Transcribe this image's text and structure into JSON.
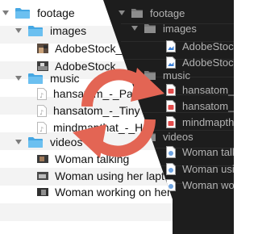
{
  "light_panel": {
    "items": [
      {
        "label": "footage",
        "icon": "folder-icon",
        "type": "folder"
      },
      {
        "label": "images",
        "icon": "folder-icon",
        "type": "folder"
      },
      {
        "label": "AdobeStock_",
        "icon": "image-thumbnail-icon",
        "type": "file"
      },
      {
        "label": "AdobeStock_",
        "icon": "image-thumbnail-icon",
        "type": "file"
      },
      {
        "label": "music",
        "icon": "folder-icon",
        "type": "folder"
      },
      {
        "label": "hansatom_-_Pa",
        "icon": "audio-file-icon",
        "type": "file"
      },
      {
        "label": "hansatom_-_Tiny",
        "icon": "audio-file-icon",
        "type": "file"
      },
      {
        "label": "mindmapthat_-_H",
        "icon": "audio-file-icon",
        "type": "file"
      },
      {
        "label": "videos",
        "icon": "folder-icon",
        "type": "folder"
      },
      {
        "label": "Woman talking",
        "icon": "video-thumbnail-icon",
        "type": "file"
      },
      {
        "label": "Woman using her laptop",
        "icon": "video-thumbnail-icon",
        "type": "file"
      },
      {
        "label": "Woman working on her l",
        "icon": "video-thumbnail-icon",
        "type": "file"
      }
    ]
  },
  "dark_panel": {
    "items": [
      {
        "label": "footage",
        "icon": "folder-icon",
        "type": "folder"
      },
      {
        "label": "images",
        "icon": "folder-icon",
        "type": "folder"
      },
      {
        "label": "AdobeStock_",
        "icon": "image-file-icon",
        "type": "file"
      },
      {
        "label": "AdobeStock_",
        "icon": "image-file-icon",
        "type": "file"
      },
      {
        "label": "music",
        "icon": "folder-icon",
        "type": "folder"
      },
      {
        "label": "hansatom_-_",
        "icon": "audio-file-icon",
        "type": "file"
      },
      {
        "label": "hansatom_-_",
        "icon": "audio-file-icon",
        "type": "file"
      },
      {
        "label": "mindmapthat",
        "icon": "audio-file-icon",
        "type": "file"
      },
      {
        "label": "videos",
        "icon": "folder-icon",
        "type": "folder"
      },
      {
        "label": "Woman talki",
        "icon": "video-file-icon",
        "type": "file"
      },
      {
        "label": "Woman using",
        "icon": "video-file-icon",
        "type": "file"
      },
      {
        "label": "Woman work",
        "icon": "video-file-icon",
        "type": "file"
      }
    ]
  },
  "sync_icon": {
    "name": "sync-arrows-icon",
    "color": "#e36554"
  },
  "colors": {
    "light_folder": "#45a7e3",
    "dark_folder": "#7a7a7a",
    "dark_bg": "#1d1d1d",
    "dark_image_icon": "#3a7fd6",
    "dark_audio_icon": "#e34b4b",
    "dark_video_icon": "#6ea3e0"
  }
}
